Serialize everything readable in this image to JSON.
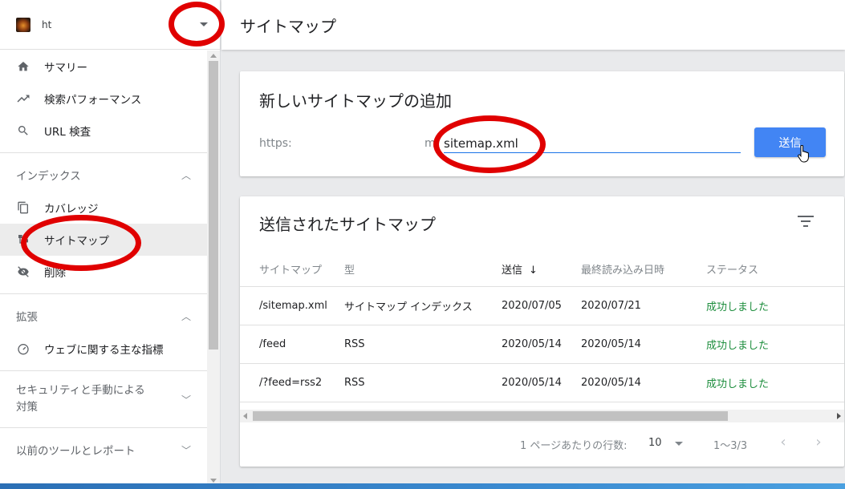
{
  "property": {
    "name": "ht",
    "favicon": "site-favicon"
  },
  "sidebar": {
    "top_items": [
      {
        "label": "サマリー",
        "icon": "home-icon"
      },
      {
        "label": "検索パフォーマンス",
        "icon": "trending-up-icon"
      },
      {
        "label": "URL 検査",
        "icon": "search-icon"
      }
    ],
    "sections": [
      {
        "label": "インデックス",
        "expanded": true,
        "items": [
          {
            "label": "カバレッジ",
            "icon": "copy-icon"
          },
          {
            "label": "サイトマップ",
            "icon": "sitemap-icon",
            "active": true
          },
          {
            "label": "削除",
            "icon": "eye-off-icon"
          }
        ]
      },
      {
        "label": "拡張",
        "expanded": true,
        "items": [
          {
            "label": "ウェブに関する主な指標",
            "icon": "gauge-icon"
          }
        ]
      },
      {
        "label": "セキュリティと手動による対策",
        "expanded": false,
        "items": []
      },
      {
        "label": "以前のツールとレポート",
        "expanded": false,
        "items": []
      }
    ]
  },
  "header": {
    "title": "サイトマップ"
  },
  "add_card": {
    "title": "新しいサイトマップの追加",
    "prefix": "https:",
    "prefix_tail": "m",
    "input_value": "sitemap.xml",
    "submit_label": "送信"
  },
  "list_card": {
    "title": "送信されたサイトマップ",
    "columns": [
      "サイトマップ",
      "型",
      "送信",
      "最終読み込み日時",
      "ステータス"
    ],
    "sort_arrow": "↓",
    "rows": [
      {
        "sitemap": "/sitemap.xml",
        "type": "サイトマップ インデックス",
        "submitted": "2020/07/05",
        "last_read": "2020/07/21",
        "status": "成功しました"
      },
      {
        "sitemap": "/feed",
        "type": "RSS",
        "submitted": "2020/05/14",
        "last_read": "2020/05/14",
        "status": "成功しました"
      },
      {
        "sitemap": "/?feed=rss2",
        "type": "RSS",
        "submitted": "2020/05/14",
        "last_read": "2020/05/14",
        "status": "成功しました"
      }
    ],
    "pager": {
      "rows_label": "1 ページあたりの行数:",
      "rows_value": "10",
      "range": "1～3/3"
    }
  },
  "colors": {
    "accent": "#4285f4",
    "success": "#1e8e3e",
    "annotation": "#e00000"
  }
}
